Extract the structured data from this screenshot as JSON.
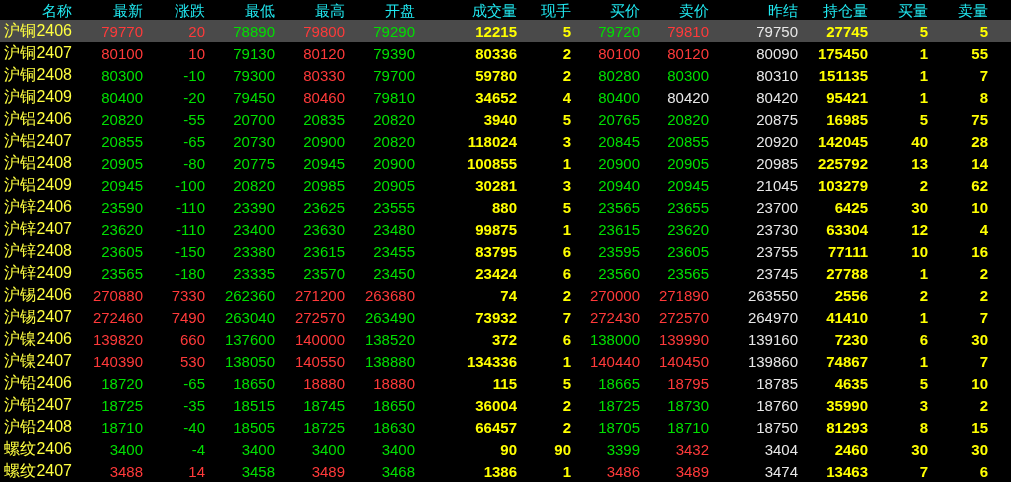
{
  "columns": [
    {
      "label": "名称",
      "kind": "name"
    },
    {
      "label": "最新",
      "kind": "price"
    },
    {
      "label": "涨跌",
      "kind": "change"
    },
    {
      "label": "最低",
      "kind": "price"
    },
    {
      "label": "最高",
      "kind": "price"
    },
    {
      "label": "开盘",
      "kind": "price"
    },
    {
      "label": "成交量",
      "kind": "volume"
    },
    {
      "label": "现手",
      "kind": "volume"
    },
    {
      "label": "买价",
      "kind": "price"
    },
    {
      "label": "卖价",
      "kind": "price"
    },
    {
      "label": "昨结",
      "kind": "settle"
    },
    {
      "label": "持仓量",
      "kind": "volume"
    },
    {
      "label": "买量",
      "kind": "volume"
    },
    {
      "label": "卖量",
      "kind": "volume"
    }
  ],
  "rows": [
    {
      "selected": true,
      "cells": [
        "沪铜2406",
        "79770",
        "20",
        "78890",
        "79800",
        "79290",
        "12215",
        "5",
        "79720",
        "79810",
        "79750",
        "27745",
        "5",
        "5"
      ]
    },
    {
      "selected": false,
      "cells": [
        "沪铜2407",
        "80100",
        "10",
        "79130",
        "80120",
        "79390",
        "80336",
        "2",
        "80100",
        "80120",
        "80090",
        "175450",
        "1",
        "55"
      ]
    },
    {
      "selected": false,
      "cells": [
        "沪铜2408",
        "80300",
        "-10",
        "79300",
        "80330",
        "79700",
        "59780",
        "2",
        "80280",
        "80300",
        "80310",
        "151135",
        "1",
        "7"
      ]
    },
    {
      "selected": false,
      "cells": [
        "沪铜2409",
        "80400",
        "-20",
        "79450",
        "80460",
        "79810",
        "34652",
        "4",
        "80400",
        "80420",
        "80420",
        "95421",
        "1",
        "8"
      ]
    },
    {
      "selected": false,
      "cells": [
        "沪铝2406",
        "20820",
        "-55",
        "20700",
        "20835",
        "20820",
        "3940",
        "5",
        "20765",
        "20820",
        "20875",
        "16985",
        "5",
        "75"
      ]
    },
    {
      "selected": false,
      "cells": [
        "沪铝2407",
        "20855",
        "-65",
        "20730",
        "20900",
        "20820",
        "118024",
        "3",
        "20845",
        "20855",
        "20920",
        "142045",
        "40",
        "28"
      ]
    },
    {
      "selected": false,
      "cells": [
        "沪铝2408",
        "20905",
        "-80",
        "20775",
        "20945",
        "20900",
        "100855",
        "1",
        "20900",
        "20905",
        "20985",
        "225792",
        "13",
        "14"
      ]
    },
    {
      "selected": false,
      "cells": [
        "沪铝2409",
        "20945",
        "-100",
        "20820",
        "20985",
        "20905",
        "30281",
        "3",
        "20940",
        "20945",
        "21045",
        "103279",
        "2",
        "62"
      ]
    },
    {
      "selected": false,
      "cells": [
        "沪锌2406",
        "23590",
        "-110",
        "23390",
        "23625",
        "23555",
        "880",
        "5",
        "23565",
        "23655",
        "23700",
        "6425",
        "30",
        "10"
      ]
    },
    {
      "selected": false,
      "cells": [
        "沪锌2407",
        "23620",
        "-110",
        "23400",
        "23630",
        "23480",
        "99875",
        "1",
        "23615",
        "23620",
        "23730",
        "63304",
        "12",
        "4"
      ]
    },
    {
      "selected": false,
      "cells": [
        "沪锌2408",
        "23605",
        "-150",
        "23380",
        "23615",
        "23455",
        "83795",
        "6",
        "23595",
        "23605",
        "23755",
        "77111",
        "10",
        "16"
      ]
    },
    {
      "selected": false,
      "cells": [
        "沪锌2409",
        "23565",
        "-180",
        "23335",
        "23570",
        "23450",
        "23424",
        "6",
        "23560",
        "23565",
        "23745",
        "27788",
        "1",
        "2"
      ]
    },
    {
      "selected": false,
      "cells": [
        "沪锡2406",
        "270880",
        "7330",
        "262360",
        "271200",
        "263680",
        "74",
        "2",
        "270000",
        "271890",
        "263550",
        "2556",
        "2",
        "2"
      ]
    },
    {
      "selected": false,
      "cells": [
        "沪锡2407",
        "272460",
        "7490",
        "263040",
        "272570",
        "263490",
        "73932",
        "7",
        "272430",
        "272570",
        "264970",
        "41410",
        "1",
        "7"
      ]
    },
    {
      "selected": false,
      "cells": [
        "沪镍2406",
        "139820",
        "660",
        "137600",
        "140000",
        "138520",
        "372",
        "6",
        "138000",
        "139990",
        "139160",
        "7230",
        "6",
        "30"
      ]
    },
    {
      "selected": false,
      "cells": [
        "沪镍2407",
        "140390",
        "530",
        "138050",
        "140550",
        "138880",
        "134336",
        "1",
        "140440",
        "140450",
        "139860",
        "74867",
        "1",
        "7"
      ]
    },
    {
      "selected": false,
      "cells": [
        "沪铅2406",
        "18720",
        "-65",
        "18650",
        "18880",
        "18880",
        "115",
        "5",
        "18665",
        "18795",
        "18785",
        "4635",
        "5",
        "10"
      ]
    },
    {
      "selected": false,
      "cells": [
        "沪铅2407",
        "18725",
        "-35",
        "18515",
        "18745",
        "18650",
        "36004",
        "2",
        "18725",
        "18730",
        "18760",
        "35990",
        "3",
        "2"
      ]
    },
    {
      "selected": false,
      "cells": [
        "沪铅2408",
        "18710",
        "-40",
        "18505",
        "18725",
        "18630",
        "66457",
        "2",
        "18705",
        "18710",
        "18750",
        "81293",
        "8",
        "15"
      ]
    },
    {
      "selected": false,
      "cells": [
        "螺纹2406",
        "3400",
        "-4",
        "3400",
        "3400",
        "3400",
        "90",
        "90",
        "3399",
        "3432",
        "3404",
        "2460",
        "30",
        "30"
      ]
    },
    {
      "selected": false,
      "cells": [
        "螺纹2407",
        "3488",
        "14",
        "3458",
        "3489",
        "3468",
        "1386",
        "1",
        "3486",
        "3489",
        "3474",
        "13463",
        "7",
        "6"
      ]
    }
  ]
}
